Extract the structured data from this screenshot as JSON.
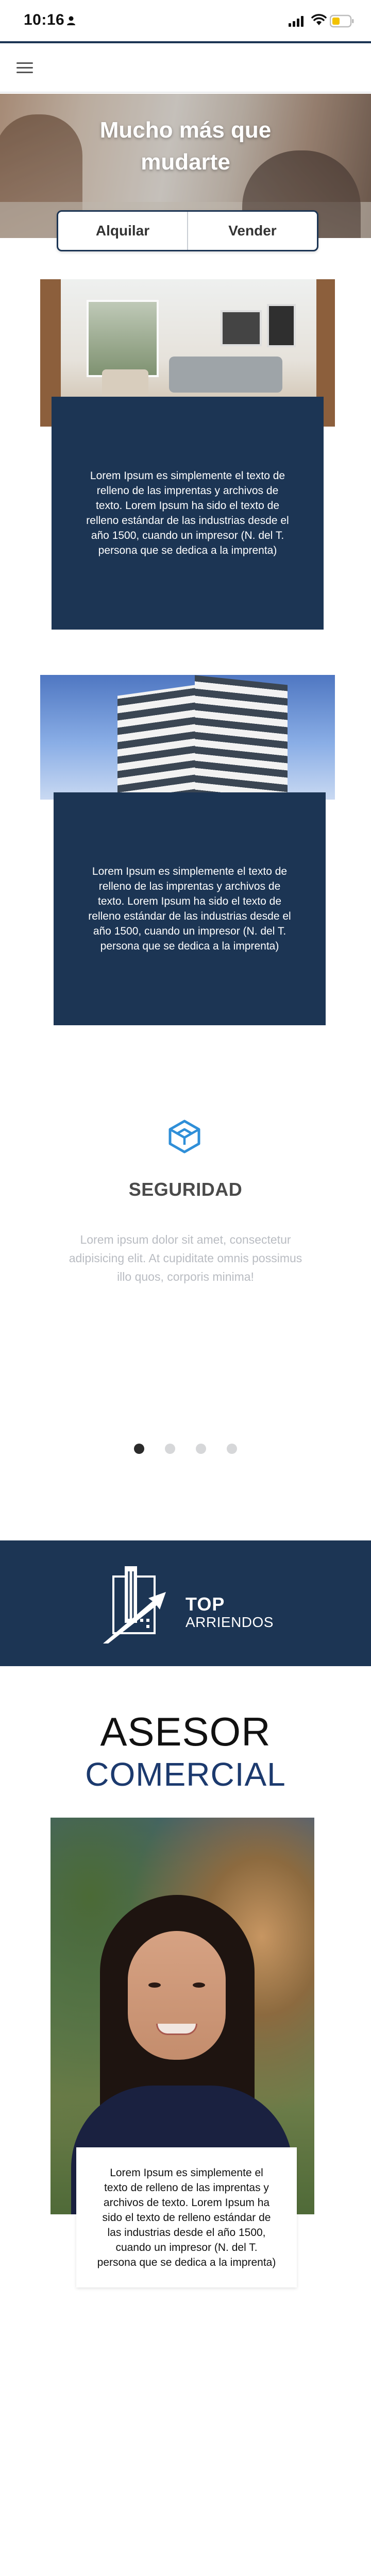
{
  "status_bar": {
    "time": "10:16"
  },
  "hero": {
    "title": "Mucho más que mudarte",
    "tabs": [
      "Alquilar",
      "Vender"
    ]
  },
  "cards": [
    {
      "image": "living-room-photo",
      "text": "Lorem Ipsum es simplemente el texto de relleno de las imprentas y archivos de texto. Lorem Ipsum ha sido el texto de relleno estándar de las industrias desde el año 1500, cuando un impresor (N. del T. persona que se dedica a la imprenta)"
    },
    {
      "image": "building-photo",
      "text": "Lorem Ipsum es simplemente el texto de relleno de las imprentas y archivos de texto. Lorem Ipsum ha sido el texto de relleno estándar de las industrias desde el año 1500, cuando un impresor (N. del T. persona que se dedica a la imprenta)"
    }
  ],
  "feature": {
    "icon": "cube-icon",
    "title": "SEGURIDAD",
    "text": "Lorem ipsum dolor sit amet, consectetur adipisicing elit. At cupiditate omnis possimus illo quos, corporis minima!",
    "active_slide": 1,
    "slide_count": 4
  },
  "brand": {
    "name_bold": "TOP",
    "name_sub": "ARRIENDOS"
  },
  "advisor": {
    "title": "ASESOR",
    "subtitle": "COMERCIAL",
    "text": "Lorem Ipsum es simplemente el texto de relleno de las imprentas y archivos de texto. Lorem Ipsum ha sido el texto de relleno estándar de las industrias desde el año 1500, cuando un impresor (N. del T. persona que se dedica a la imprenta)"
  },
  "colors": {
    "primary_navy": "#1c3554",
    "accent_blue": "#2f8fd8",
    "subtitle_blue": "#1c3a6e"
  }
}
